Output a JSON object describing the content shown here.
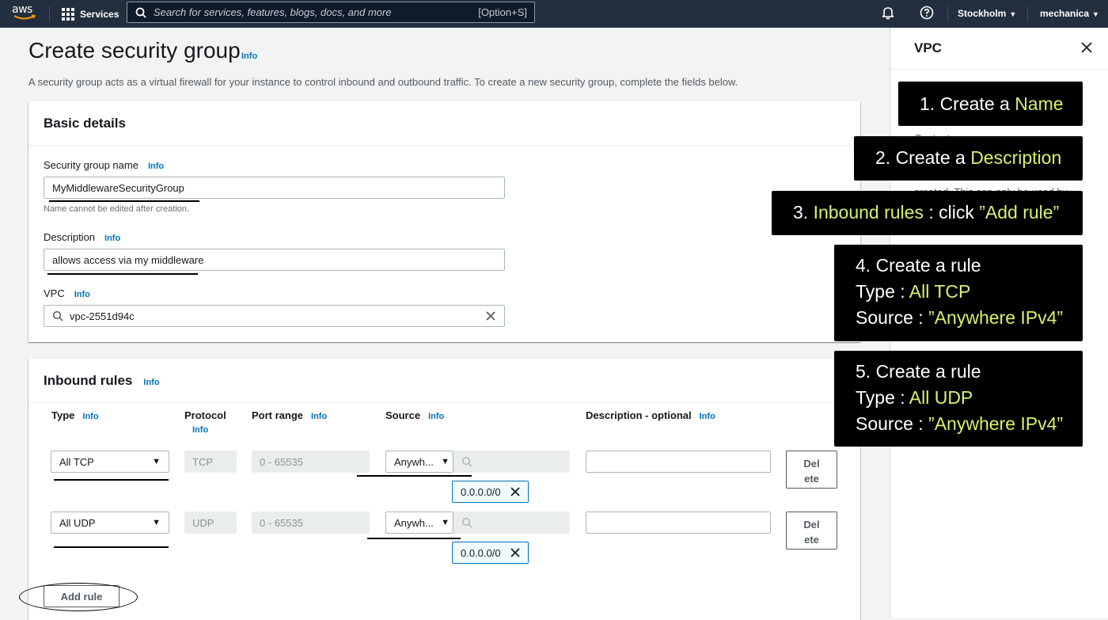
{
  "topnav": {
    "logo": "aws",
    "services": "Services",
    "search_placeholder": "Search for services, features, blogs, docs, and more",
    "search_shortcut": "[Option+S]",
    "region": "Stockholm",
    "account": "mechanica",
    "icons": [
      "grid-icon",
      "search-icon",
      "bell-icon",
      "help-icon"
    ]
  },
  "page": {
    "title": "Create security group",
    "title_info": "Info",
    "description": "A security group acts as a virtual firewall for your instance to control inbound and outbound traffic. To create a new security group, complete the fields below."
  },
  "basic": {
    "header": "Basic details",
    "name_label": "Security group name",
    "name_info": "Info",
    "name_value": "MyMiddlewareSecurityGroup",
    "name_hint": "Name cannot be edited after creation.",
    "desc_label": "Description",
    "desc_info": "Info",
    "desc_value": "allows access via my middleware",
    "vpc_label": "VPC",
    "vpc_info": "Info",
    "vpc_value": "vpc-2551d94c"
  },
  "inbound": {
    "header": "Inbound rules",
    "header_info": "Info",
    "columns": {
      "type": "Type",
      "type_info": "Info",
      "protocol": "Protocol",
      "protocol_info": "Info",
      "port_range": "Port range",
      "port_info": "Info",
      "source": "Source",
      "source_info": "Info",
      "description": "Description - optional",
      "description_info": "Info"
    },
    "rules": [
      {
        "type": "All TCP",
        "protocol": "TCP",
        "port_range": "0 - 65535",
        "source": "Anywh...",
        "cidr": "0.0.0.0/0",
        "description": "",
        "delete_line1": "Del",
        "delete_line2": "ete"
      },
      {
        "type": "All UDP",
        "protocol": "UDP",
        "port_range": "0 - 65535",
        "source": "Anywh...",
        "cidr": "0.0.0.0/0",
        "description": "",
        "delete_line1": "Del",
        "delete_line2": "ete"
      }
    ],
    "add_rule": "Add rule"
  },
  "help_panel": {
    "title": "VPC",
    "partial_text_1": "Content",
    "partial_text_2": "created. This can only be used by"
  },
  "callouts": {
    "c1": {
      "prefix": "1. Create a ",
      "highlight": "Name"
    },
    "c2": {
      "prefix": "2. Create a ",
      "highlight": "Description"
    },
    "c3": {
      "prefix": "3. ",
      "highlight1": "Inbound rules",
      "middle": " : click ",
      "highlight2": "”Add rule”"
    },
    "c4": {
      "line1": "4. Create a rule",
      "type_label": "Type : ",
      "type_value": "All TCP",
      "source_label": "Source : ",
      "source_value": "”Anywhere IPv4”"
    },
    "c5": {
      "line1": "5. Create a rule",
      "type_label": "Type : ",
      "type_value": "All UDP",
      "source_label": "Source : ",
      "source_value": "”Anywhere IPv4”"
    }
  },
  "colors": {
    "nav_bg": "#232f3e",
    "link": "#0073bb",
    "callout_bg": "#000000",
    "callout_highlight": "#d7f06e"
  }
}
